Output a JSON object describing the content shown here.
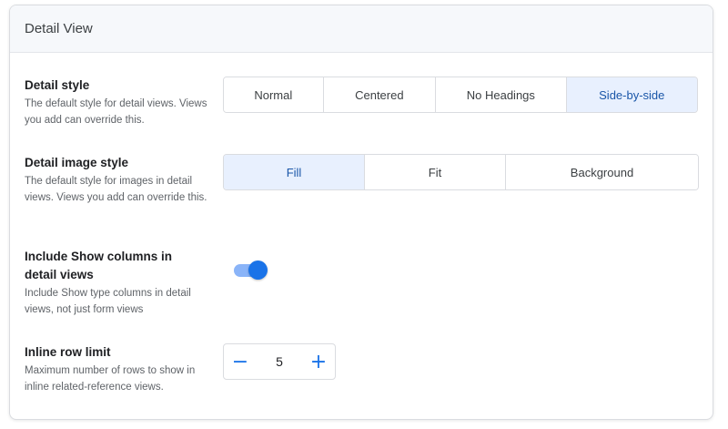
{
  "card": {
    "title": "Detail View"
  },
  "detail_style": {
    "title": "Detail style",
    "description": "The default style for detail views. Views you add can override this.",
    "options": [
      "Normal",
      "Centered",
      "No Headings",
      "Side-by-side"
    ],
    "selected": "Side-by-side"
  },
  "detail_image_style": {
    "title": "Detail image style",
    "description": "The default style for images in detail views. Views you add can override this.",
    "options": [
      "Fill",
      "Fit",
      "Background"
    ],
    "selected": "Fill"
  },
  "include_show_columns": {
    "title": "Include Show columns in detail views",
    "description": "Include Show type columns in detail views, not just form views",
    "enabled": true
  },
  "inline_row_limit": {
    "title": "Inline row limit",
    "description": "Maximum number of rows to show in inline related-reference views.",
    "value": "5",
    "decrement_symbol": "−",
    "increment_symbol": "+"
  },
  "colors": {
    "accent": "#1a73e8",
    "selected_bg": "#e8f0fe",
    "selected_text": "#1a56a8",
    "border": "#dadce0",
    "header_bg": "#f6f8fb"
  }
}
